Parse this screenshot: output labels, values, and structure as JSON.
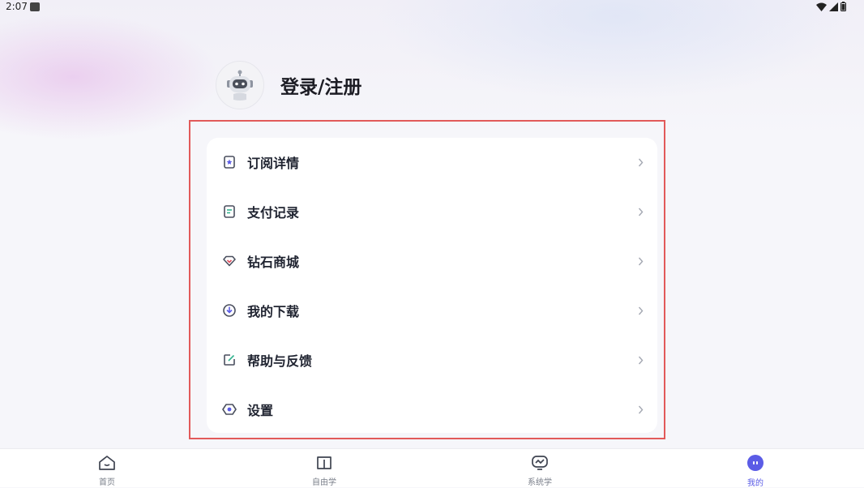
{
  "status_bar": {
    "time": "2:07",
    "icons": [
      "wifi-icon",
      "signal-icon",
      "battery-icon"
    ]
  },
  "profile": {
    "login_label": "登录/注册"
  },
  "menu": {
    "items": [
      {
        "label": "订阅详情",
        "icon": "subscription-icon"
      },
      {
        "label": "支付记录",
        "icon": "payment-record-icon"
      },
      {
        "label": "钻石商城",
        "icon": "diamond-icon"
      },
      {
        "label": "我的下载",
        "icon": "download-icon"
      },
      {
        "label": "帮助与反馈",
        "icon": "feedback-icon"
      },
      {
        "label": "设置",
        "icon": "settings-icon"
      }
    ]
  },
  "tab_bar": {
    "tabs": [
      {
        "label": "首页",
        "icon": "home-icon"
      },
      {
        "label": "自由学",
        "icon": "book-icon"
      },
      {
        "label": "系统学",
        "icon": "chart-board-icon"
      },
      {
        "label": "我的",
        "icon": "profile-robot-icon"
      }
    ],
    "active_index": 3
  },
  "colors": {
    "accent": "#5b5ce6",
    "highlight_border": "#e25a5a",
    "menu_icon": "#4a4f5e",
    "tab_inactive": "#7a7f8a"
  }
}
